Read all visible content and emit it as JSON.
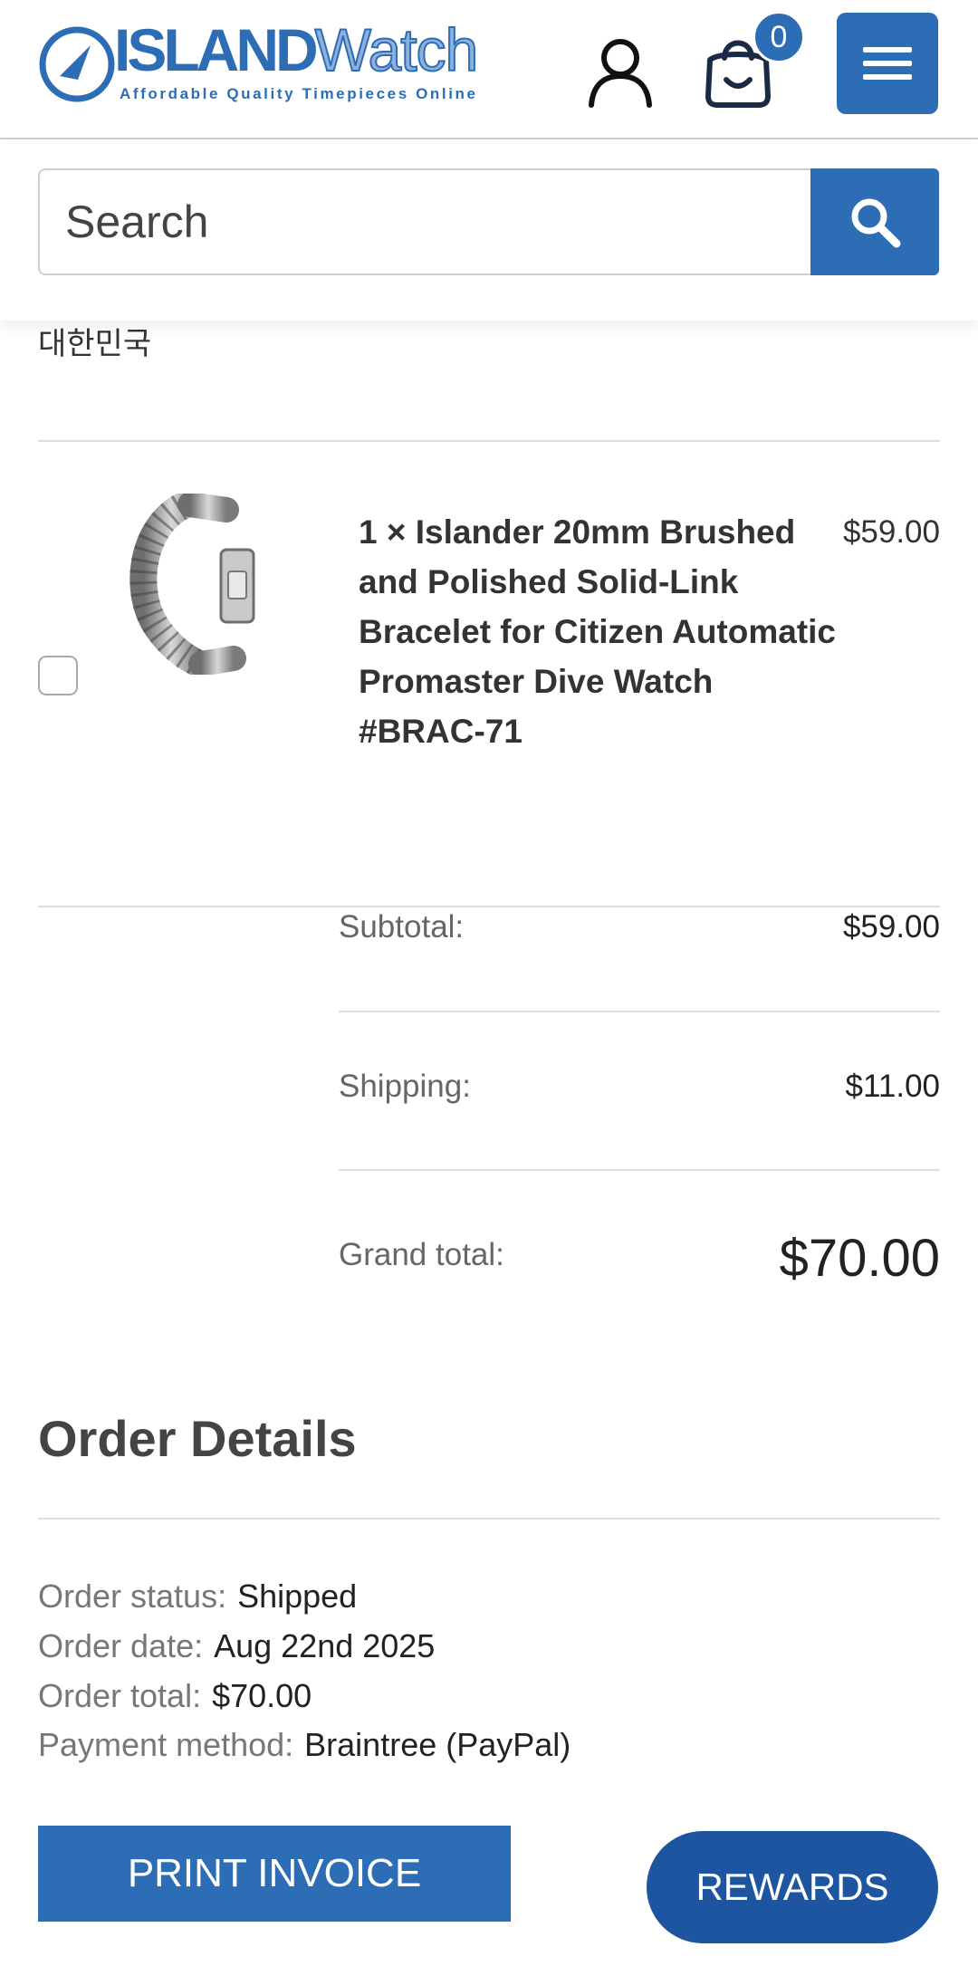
{
  "header": {
    "logo_primary": "ISLAND",
    "logo_secondary": "Watch",
    "logo_tagline": "Affordable Quality Timepieces Online",
    "cart_count": "0",
    "account_icon": "user-icon",
    "cart_icon": "shopping-bag-icon",
    "menu_icon": "hamburger-menu-icon"
  },
  "search": {
    "placeholder": "Search",
    "icon": "search-icon"
  },
  "address": {
    "country": "대한민국"
  },
  "items": [
    {
      "title": "1 × Islander 20mm Brushed and Polished Solid-Link Bracelet for Citizen Automatic Promaster Dive Watch #BRAC-71",
      "price": "$59.00",
      "selected": false
    }
  ],
  "totals": {
    "subtotal_label": "Subtotal:",
    "subtotal_value": "$59.00",
    "shipping_label": "Shipping:",
    "shipping_value": "$11.00",
    "grand_label": "Grand total:",
    "grand_value": "$70.00"
  },
  "order_details": {
    "title": "Order Details",
    "status_label": "Order status:",
    "status_value": "Shipped",
    "date_label": "Order date:",
    "date_value": "Aug 22nd 2025",
    "total_label": "Order total:",
    "total_value": "$70.00",
    "payment_label": "Payment method:",
    "payment_value": "Braintree (PayPal)"
  },
  "actions": {
    "print_label": "PRINT INVOICE",
    "rewards_label": "REWARDS"
  },
  "colors": {
    "brand_blue": "#2d6db5",
    "rewards_blue": "#1d55a0"
  }
}
